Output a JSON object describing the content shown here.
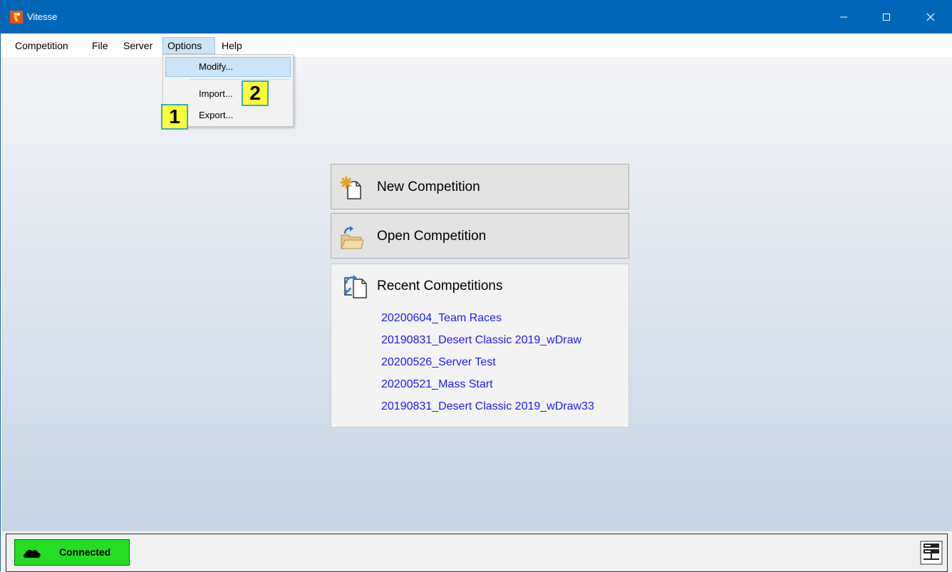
{
  "window": {
    "title": "Vitesse"
  },
  "menubar": {
    "items": [
      {
        "label": "Competition"
      },
      {
        "label": "File"
      },
      {
        "label": "Server"
      },
      {
        "label": "Options"
      },
      {
        "label": "Help"
      }
    ]
  },
  "options_menu": {
    "items": [
      {
        "label": "Modify..."
      },
      {
        "label": "Import..."
      },
      {
        "label": "Export..."
      }
    ]
  },
  "callouts": {
    "first": "1",
    "second": "2"
  },
  "main": {
    "new_label": "New Competition",
    "open_label": "Open Competition",
    "recent": {
      "title": "Recent Competitions",
      "items": [
        "20200604_Team Races",
        "20190831_Desert Classic 2019_wDraw",
        "20200526_Server Test",
        "20200521_Mass Start",
        "20190831_Desert Classic 2019_wDraw33"
      ]
    }
  },
  "status": {
    "connection_label": "Connected",
    "connection_color": "#22dd22"
  },
  "colors": {
    "titlebar": "#0067b8",
    "link": "#1a1aff",
    "highlight": "#cce4f7",
    "callout": "#ffff33"
  }
}
